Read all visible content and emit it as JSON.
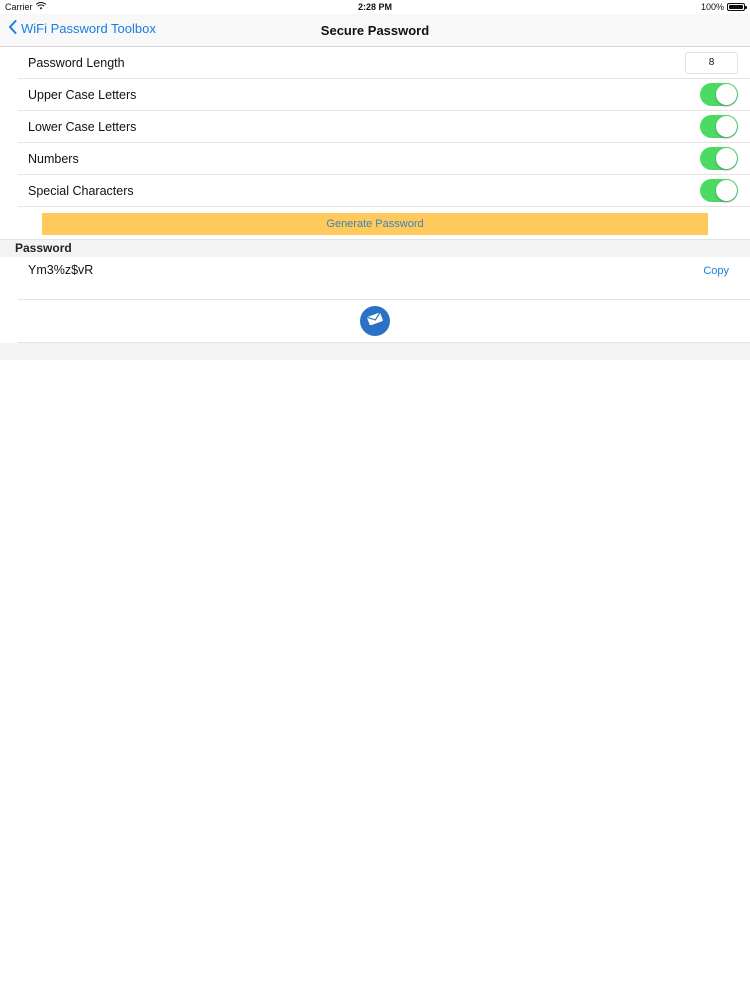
{
  "status_bar": {
    "carrier": "Carrier",
    "time": "2:28 PM",
    "battery": "100%"
  },
  "nav": {
    "back_label": "WiFi Password Toolbox",
    "title": "Secure Password"
  },
  "settings": {
    "password_length_label": "Password Length",
    "password_length_value": "8",
    "options": [
      {
        "label": "Upper Case Letters",
        "enabled": true
      },
      {
        "label": "Lower Case Letters",
        "enabled": true
      },
      {
        "label": "Numbers",
        "enabled": true
      },
      {
        "label": "Special Characters",
        "enabled": true
      }
    ]
  },
  "generate_button": "Generate Password",
  "password_section": {
    "header": "Password",
    "value": "Ym3%z$vR",
    "copy_label": "Copy"
  },
  "icons": {
    "back": "chevron-left-icon",
    "wifi": "wifi-icon",
    "battery": "battery-icon",
    "mail": "mail-icon"
  },
  "colors": {
    "accent": "#1a7ee0",
    "toggle_on": "#4cd964",
    "generate_button_bg": "#ffc95c",
    "generate_button_text": "#3d86b8",
    "mail_button": "#2b72c6"
  }
}
